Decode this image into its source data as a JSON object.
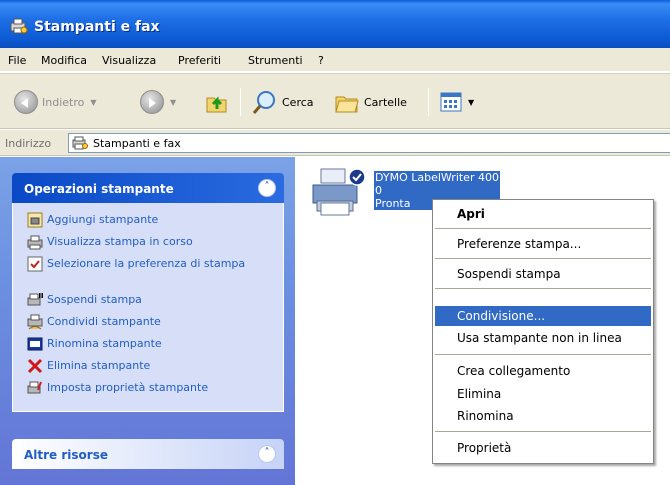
{
  "window": {
    "title": "Stampanti e fax"
  },
  "menubar": {
    "items": [
      "File",
      "Modifica",
      "Visualizza",
      "Preferiti",
      "Strumenti",
      "?"
    ]
  },
  "toolbar": {
    "back_label": "Indietro",
    "search_label": "Cerca",
    "folders_label": "Cartelle"
  },
  "address": {
    "label": "Indirizzo",
    "value": "Stampanti e fax"
  },
  "sidebar": {
    "printer_tasks": {
      "title": "Operazioni stampante",
      "items": [
        {
          "label": "Aggiungi stampante",
          "icon": "add-printer-icon"
        },
        {
          "label": "Visualizza stampa in corso",
          "icon": "print-queue-icon"
        },
        {
          "label": "Selezionare la preferenza di stampa",
          "icon": "print-preference-icon"
        },
        {
          "label": "Sospendi stampa",
          "icon": "pause-printing-icon"
        },
        {
          "label": "Condividi stampante",
          "icon": "share-printer-icon"
        },
        {
          "label": "Rinomina stampante",
          "icon": "rename-printer-icon"
        },
        {
          "label": "Elimina stampante",
          "icon": "delete-icon"
        },
        {
          "label": "Imposta proprietà stampante",
          "icon": "printer-properties-icon"
        }
      ]
    },
    "other_resources": {
      "title": "Altre risorse"
    }
  },
  "printer": {
    "name": "DYMO LabelWriter 400",
    "jobs": "0",
    "status": "Pronta"
  },
  "context_menu": {
    "items": [
      {
        "label": "Apri",
        "bold": true
      },
      {
        "label": "Preferenze stampa..."
      },
      {
        "label": "Sospendi stampa"
      },
      {
        "label": "Condivisione...",
        "highlighted": true
      },
      {
        "label": "Usa stampante non in linea"
      },
      {
        "label": "Crea collegamento"
      },
      {
        "label": "Elimina"
      },
      {
        "label": "Rinomina"
      },
      {
        "label": "Proprietà"
      }
    ]
  },
  "colors": {
    "titlebar": "#0b58d0",
    "selection": "#316ac5",
    "task_link": "#215dc6"
  }
}
